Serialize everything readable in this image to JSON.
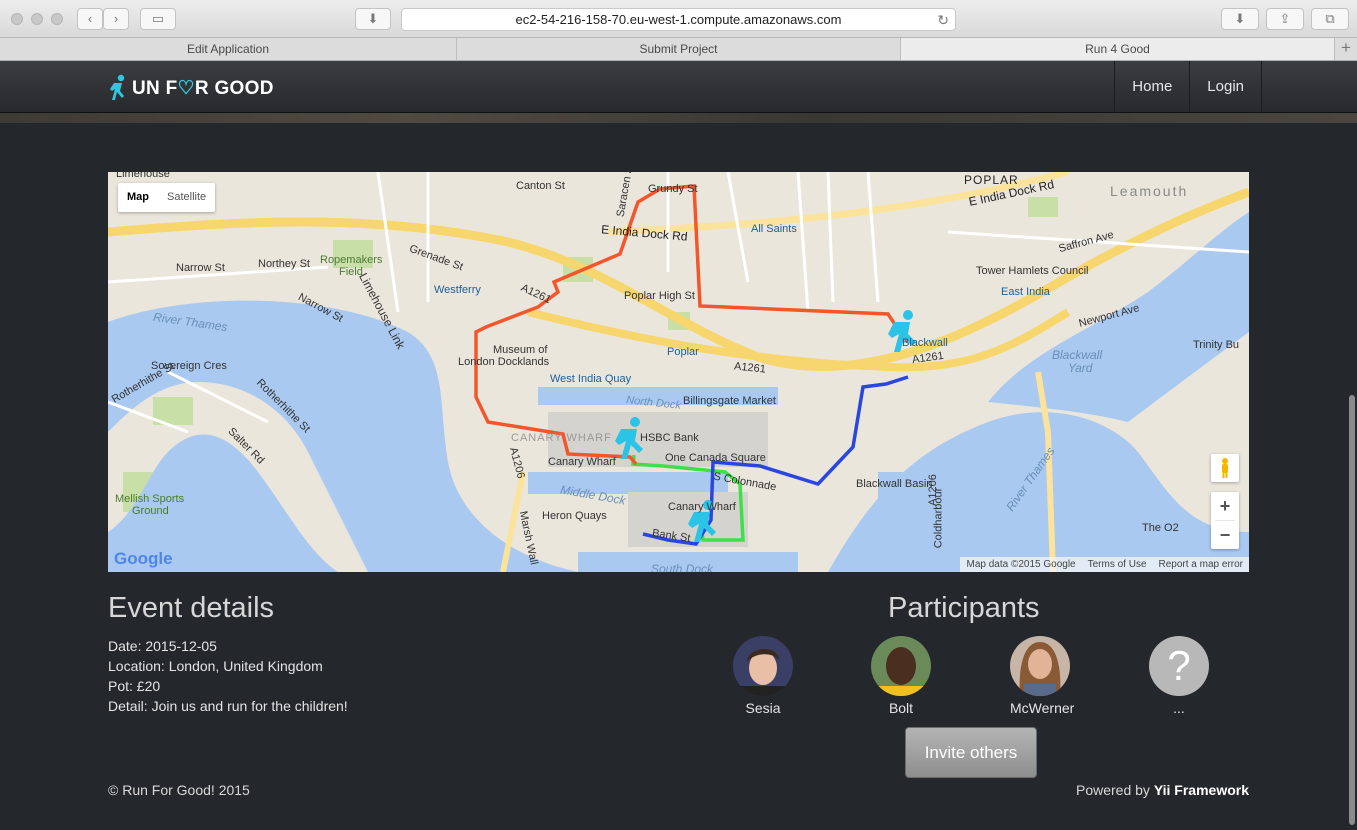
{
  "browser": {
    "url": "ec2-54-216-158-70.eu-west-1.compute.amazonaws.com",
    "tabs": [
      {
        "label": "Edit Application",
        "active": false
      },
      {
        "label": "Submit Project",
        "active": false
      },
      {
        "label": "Run 4 Good",
        "active": true
      }
    ]
  },
  "navbar": {
    "brand_prefix": "UN F",
    "brand_suffix": "R GOOD",
    "links": [
      "Home",
      "Login"
    ]
  },
  "map": {
    "type_buttons": [
      "Map",
      "Satellite"
    ],
    "attribution": [
      "Map data ©2015 Google",
      "Terms of Use",
      "Report a map error"
    ],
    "logo": "Google",
    "labels": {
      "limehouse": "Limehouse",
      "canton": "Canton St",
      "saracen": "Saracen St",
      "grundy": "Grundy St",
      "poplar_top": "POPLAR",
      "eindia1": "E India Dock Rd",
      "eindia2": "E India Dock Rd",
      "leamouth": "Leamouth",
      "allsaints": "All Saints",
      "narrow1": "Narrow St",
      "northey": "Northey St",
      "ropemakers": "Ropemakers",
      "ropemakers2": "Field",
      "grenade": "Grenade St",
      "westferry": "Westferry",
      "a1261a": "A1261",
      "poplarhigh": "Poplar High St",
      "towerhamlets": "Tower Hamlets Council",
      "saffron": "Saffron Ave",
      "eastindia": "East India",
      "newport": "Newport Ave",
      "trinity": "Trinity Bu",
      "riverthames1": "River Thames",
      "narrow2": "Narrow St",
      "limehouselink": "Limehouse Link",
      "museum1": "Museum of",
      "museum2": "London Docklands",
      "poplar": "Poplar",
      "a1261b": "A1261",
      "blackwall": "Blackwall",
      "a1261c": "A1261",
      "blackwallyard1": "Blackwall",
      "blackwallyard2": "Yard",
      "sovereign": "Sovereign Cres",
      "wiq": "West India Quay",
      "northdock": "North Dock",
      "billingsgate": "Billingsgate Market",
      "rotherhithe1": "Rotherhithe St",
      "rotherhithe2": "Rotherhithe St",
      "canarywharf_area": "CANARY WHARF",
      "hsbc": "HSBC Bank",
      "onecanada": "One Canada Square",
      "canarywharf_dlr": "Canary Wharf",
      "colonnade": "S Colonnade",
      "salter": "Salter Rd",
      "a1206a": "A1206",
      "middledock": "Middle Dock",
      "canarywharf_tube": "Canary Wharf",
      "blackwallbasin": "Blackwall Basin",
      "heronquays": "Heron Quays",
      "mellish1": "Mellish Sports",
      "mellish2": "Ground",
      "marshwall": "Marsh Wall",
      "bankst": "Bank St",
      "riverthames2": "River Thames",
      "theo2": "The O2",
      "coldharbour": "Coldharbour",
      "a1206b": "A1206",
      "southdock": "South Dock"
    }
  },
  "event": {
    "heading": "Event details",
    "date": "Date: 2015-12-05",
    "location": "Location: London, United Kingdom",
    "pot": "Pot: £20",
    "detail": "Detail: Join us and run for the children!"
  },
  "participants": {
    "heading": "Participants",
    "people": [
      {
        "name": "Sesia"
      },
      {
        "name": "Bolt"
      },
      {
        "name": "McWerner"
      },
      {
        "name": "..."
      }
    ],
    "unknown_symbol": "?",
    "invite_label": "Invite others"
  },
  "footer": {
    "copyright": "© Run For Good! 2015",
    "powered_prefix": "Powered by",
    "powered_link": "Yii Framework"
  },
  "colors": {
    "route_red": "#f4562c",
    "route_green": "#3ee04a",
    "route_blue": "#2a46e0",
    "runner": "#2bc3e6",
    "brand_accent": "#34c6dd"
  }
}
